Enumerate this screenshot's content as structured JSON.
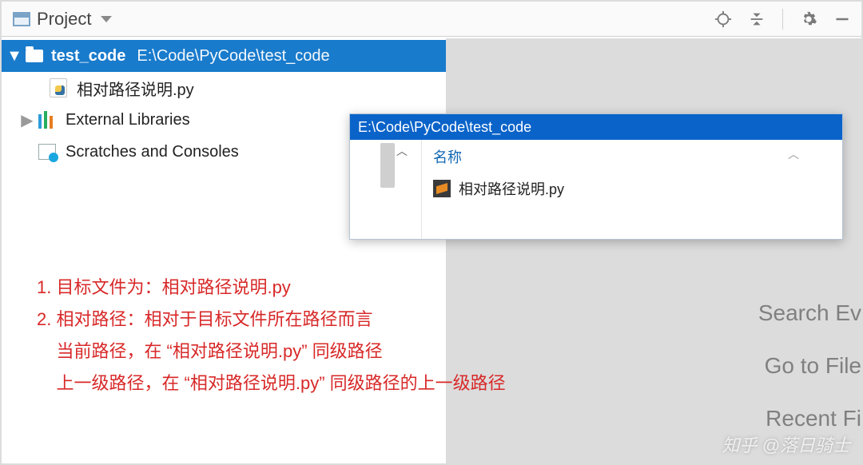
{
  "toolbar": {
    "project_label": "Project"
  },
  "tree": {
    "root": {
      "name": "test_code",
      "path": "E:\\Code\\PyCode\\test_code"
    },
    "file": "相对路径说明.py",
    "external": "External Libraries",
    "scratches": "Scratches and Consoles"
  },
  "explorer": {
    "address": "E:\\Code\\PyCode\\test_code",
    "col_name": "名称",
    "item": "相对路径说明.py"
  },
  "hints": {
    "search": "Search Ev",
    "goto": "Go to File",
    "recent": "Recent Fi"
  },
  "notes": {
    "l1": "1. 目标文件为：相对路径说明.py",
    "l2": "2. 相对路径：相对于目标文件所在路径而言",
    "l3": "    当前路径，在 “相对路径说明.py” 同级路径",
    "l4": "    上一级路径，在 “相对路径说明.py” 同级路径的上一级路径"
  },
  "watermark": "知乎 @落日骑士"
}
